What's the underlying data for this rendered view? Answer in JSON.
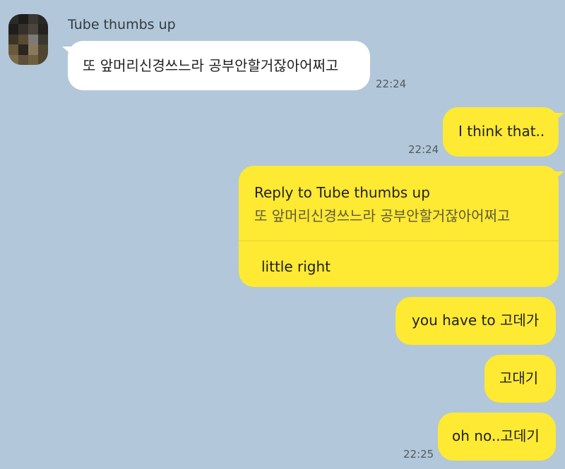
{
  "colors": {
    "background": "#b2c7d9",
    "incoming_bubble": "#ffffff",
    "outgoing_bubble": "#fee933"
  },
  "incoming": {
    "sender": "Tube thumbs up",
    "message": "또 앞머리신경쓰느라 공부안할거잖아어쩌고",
    "time": "22:24"
  },
  "outgoing": [
    {
      "text": "I think that..",
      "time": "22:24"
    },
    {
      "reply_to_label": "Reply to Tube thumbs up",
      "quoted": "또 앞머리신경쓰느라 공부안할거잖아어쩌고",
      "text": "little right"
    },
    {
      "text": "you have to 고데가"
    },
    {
      "text": "고대기"
    },
    {
      "text": "oh no..고데기",
      "time": "22:25"
    }
  ]
}
